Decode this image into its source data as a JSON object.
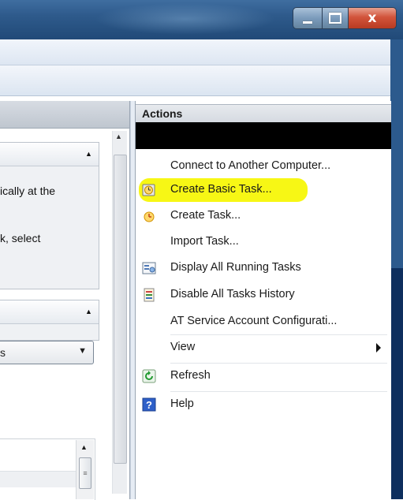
{
  "window": {
    "title_bar": {
      "minimize_glyph": "minimize-icon",
      "maximize_glyph": "maximize-icon",
      "close_glyph": "x"
    }
  },
  "center_pane": {
    "section1": {
      "line1": "ically at the",
      "line2": "k, select"
    },
    "section2": {
      "dropdown_value": "s"
    }
  },
  "actions": {
    "title": "Actions",
    "items": [
      {
        "label": "Connect to Another Computer...",
        "icon": ""
      },
      {
        "label": "Create Basic Task...",
        "icon": "create-basic-task-icon",
        "highlighted": true
      },
      {
        "label": "Create Task...",
        "icon": "create-task-icon"
      },
      {
        "label": "Import Task...",
        "icon": ""
      },
      {
        "label": "Display All Running Tasks",
        "icon": "running-tasks-icon"
      },
      {
        "label": "Disable All Tasks History",
        "icon": "tasks-history-icon"
      },
      {
        "label": "AT Service Account Configurati...",
        "icon": ""
      },
      {
        "label": "View",
        "icon": "",
        "submenu": true
      },
      {
        "label": "Refresh",
        "icon": "refresh-icon"
      },
      {
        "label": "Help",
        "icon": "help-icon"
      }
    ]
  },
  "colors": {
    "highlight": "#f7f715",
    "title_bar": "#2e5a8b",
    "close_button": "#d2543b"
  }
}
